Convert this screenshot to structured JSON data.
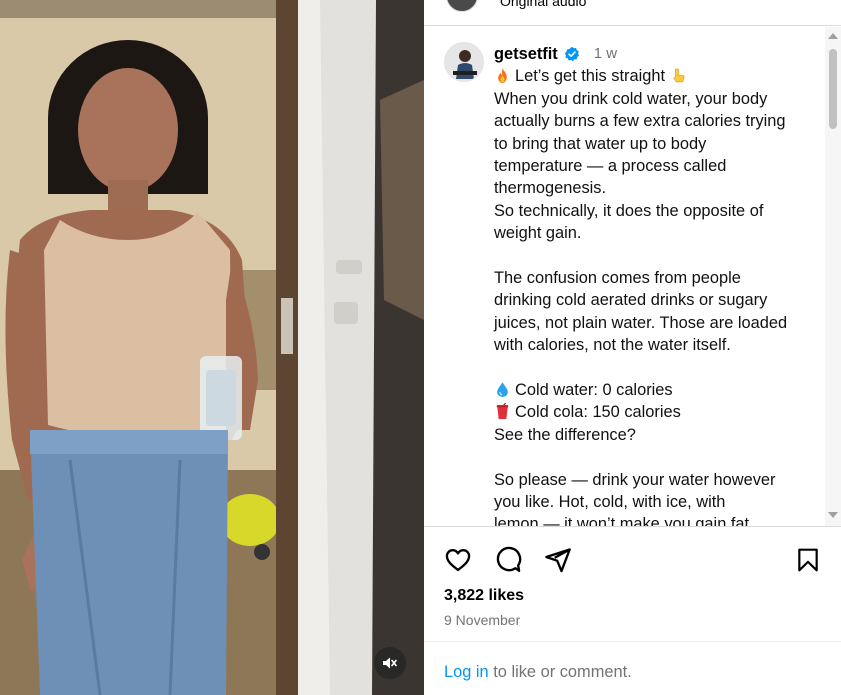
{
  "header": {
    "audio_label": "Original audio"
  },
  "post": {
    "username": "getsetfit",
    "verified": true,
    "time_ago": "1 w",
    "caption_lines": [
      {
        "emoji": "fire",
        "text": "Let’s get this straight"
      },
      {
        "text": "When you drink cold water, your body"
      },
      {
        "text": "actually burns a few extra calories trying"
      },
      {
        "text": "to bring that water up to body"
      },
      {
        "text": "temperature — a process called"
      },
      {
        "text": "thermogenesis."
      },
      {
        "text": "So technically, it does the opposite of"
      },
      {
        "text": "weight gain."
      },
      {
        "text": ""
      },
      {
        "text": "The confusion comes from people"
      },
      {
        "text": "drinking cold aerated drinks or sugary"
      },
      {
        "text": "juices, not plain water. Those are loaded"
      },
      {
        "text": "with calories, not the water itself."
      },
      {
        "text": ""
      },
      {
        "emoji": "droplet",
        "text": "Cold water: 0 calories"
      },
      {
        "emoji": "cup",
        "text": "Cold cola: 150 calories"
      },
      {
        "text": "See the difference?"
      },
      {
        "text": ""
      },
      {
        "text": "So please — drink your water however"
      },
      {
        "text": "you like. Hot, cold, with ice, with"
      },
      {
        "text": "lemon — it won’t make you gain fat."
      }
    ],
    "likes": "3,822 likes",
    "date": "9 November"
  },
  "actions": {
    "like_icon": "heart-icon",
    "comment_icon": "comment-icon",
    "share_icon": "share-icon",
    "save_icon": "bookmark-icon"
  },
  "footer": {
    "login_link": "Log in",
    "login_rest": " to like or comment."
  },
  "colors": {
    "link": "#0095f6",
    "muted_text": "#737373",
    "verified_badge": "#0095f6"
  }
}
